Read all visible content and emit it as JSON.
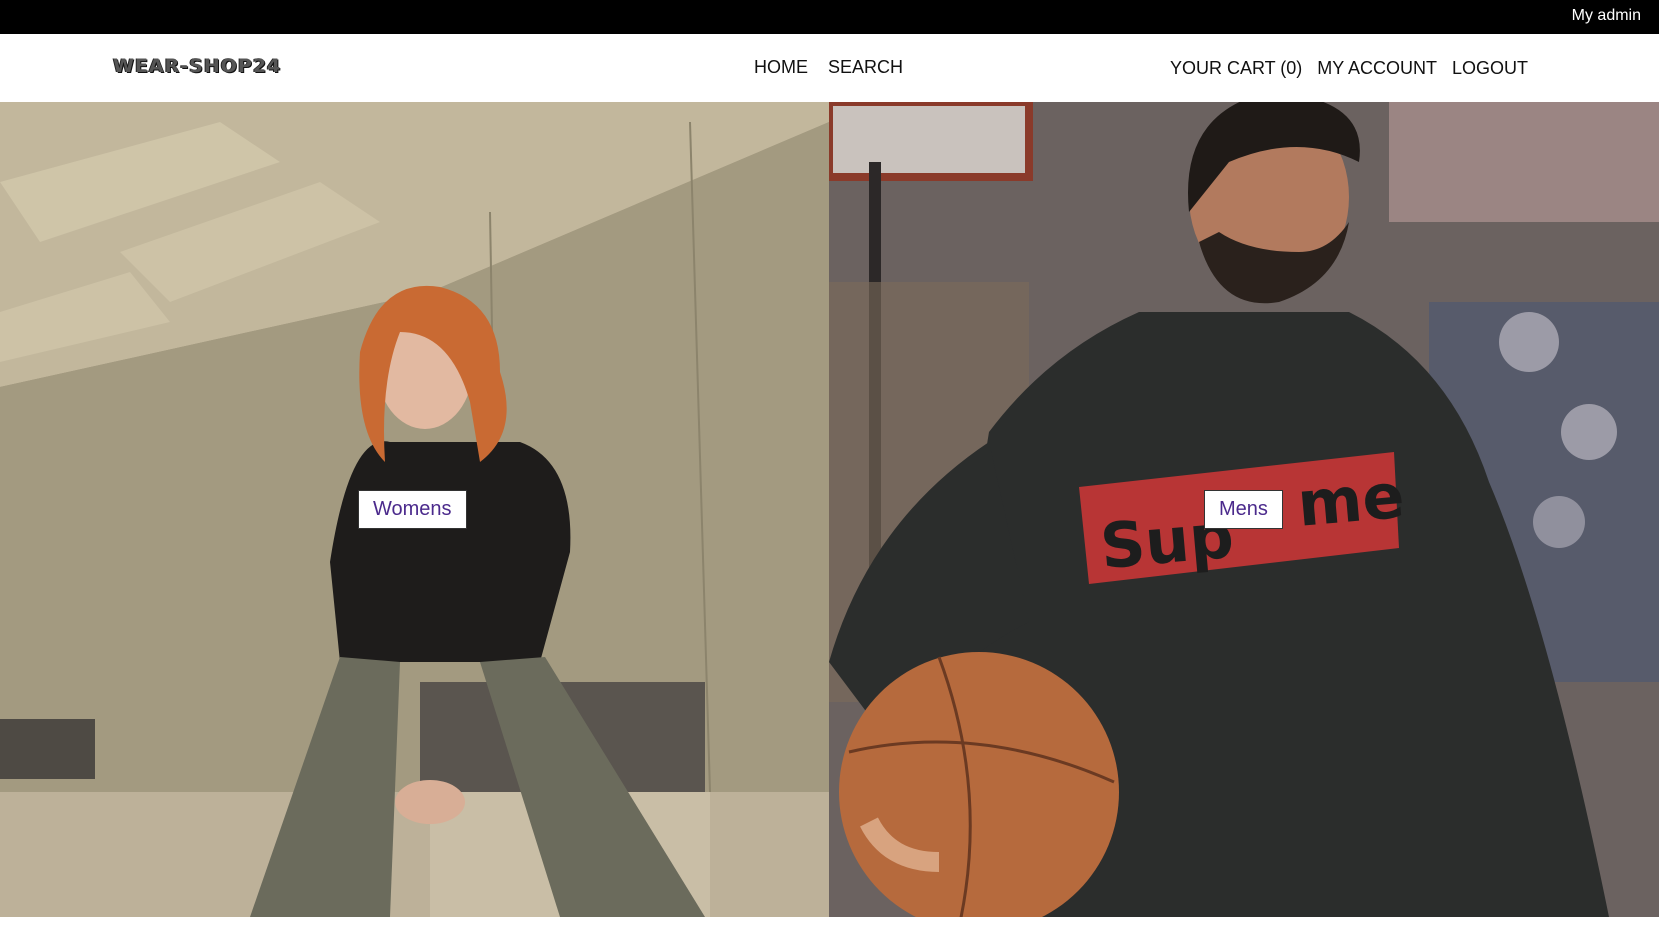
{
  "topbar": {
    "admin_link": "My admin"
  },
  "header": {
    "logo": "WEAR-SHOP24",
    "nav_center": [
      "HOME",
      "SEARCH"
    ],
    "nav_right": [
      "YOUR CART (0)",
      "MY ACCOUNT",
      "LOGOUT"
    ]
  },
  "hero": {
    "womens_label": "Womens",
    "mens_label": "Mens"
  }
}
